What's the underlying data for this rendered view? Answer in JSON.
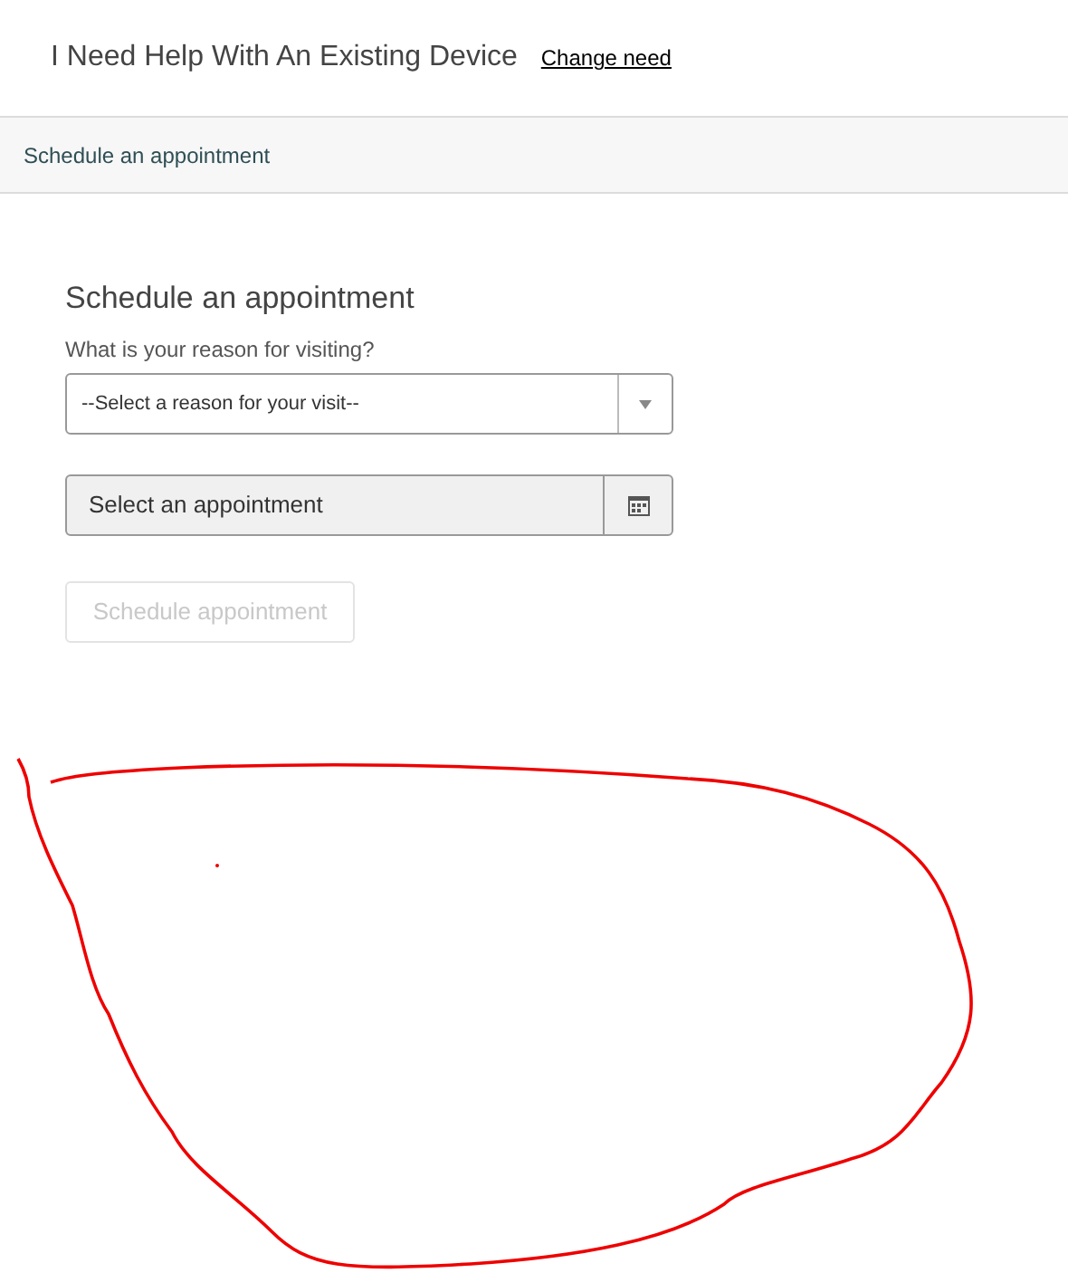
{
  "header": {
    "title": "I Need Help With An Existing Device",
    "link": "Change need"
  },
  "breadcrumb": {
    "label": "Schedule an appointment"
  },
  "form": {
    "heading": "Schedule an appointment",
    "reason": {
      "label": "What is your reason for visiting?",
      "value": "--Select a reason for your visit--"
    },
    "appointment": {
      "value": "Select an appointment"
    },
    "submit": {
      "label": "Schedule appointment",
      "disabled": true
    }
  }
}
